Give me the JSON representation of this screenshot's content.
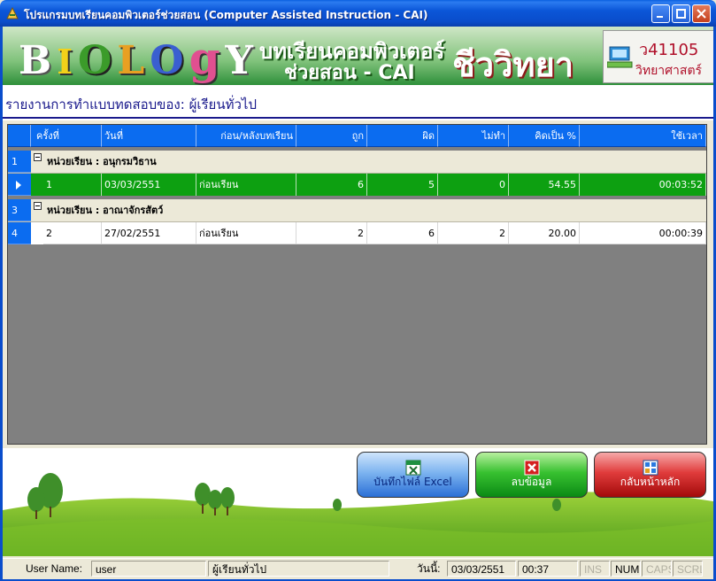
{
  "window": {
    "title": "โปรแกรมบทเรียนคอมพิวเตอร์ช่วยสอน (Computer Assisted Instruction - CAI)"
  },
  "banner": {
    "logo_letters": [
      "B",
      "I",
      "O",
      "L",
      "O",
      "g",
      "Y"
    ],
    "subtitle_line1": "บทเรียนคอมพิวเตอร์",
    "subtitle_line2": "ช่วยสอน - CAI",
    "subject": "ชีววิทยา",
    "course_code": "ว41105",
    "course_group": "วิทยาศาสตร์"
  },
  "report": {
    "title": "รายงานการทำแบบทดสอบของ: ผู้เรียนทั่วไป"
  },
  "grid": {
    "columns": [
      "ครั้งที่",
      "วันที่",
      "ก่อน/หลังบทเรียน",
      "ถูก",
      "ผิด",
      "ไม่ทำ",
      "คิดเป็น %",
      "ใช้เวลา"
    ],
    "rows": [
      {
        "rownum": "1",
        "group_label": "หน่วยเรียน : อนุกรมวิธาน"
      },
      {
        "rownum": "",
        "cells": [
          "1",
          "03/03/2551",
          "ก่อนเรียน",
          "6",
          "5",
          "0",
          "54.55",
          "00:03:52"
        ]
      },
      {
        "rownum": "3",
        "group_label": "หน่วยเรียน : อาณาจักรสัตว์"
      },
      {
        "rownum": "4",
        "cells": [
          "2",
          "27/02/2551",
          "ก่อนเรียน",
          "2",
          "6",
          "2",
          "20.00",
          "00:00:39"
        ]
      }
    ]
  },
  "buttons": {
    "excel": "บันทึกไฟล์ Excel",
    "delete": "ลบข้อมูล",
    "home": "กลับหน้าหลัก"
  },
  "statusbar": {
    "username_label": "User Name:",
    "username": "user",
    "user_type": "ผู้เรียนทั่วไป",
    "date_label": "วันนี้:",
    "date": "03/03/2551",
    "time": "00:37",
    "ins": "INS",
    "num": "NUM",
    "caps": "CAPS",
    "scrl": "SCRL"
  },
  "colors": {
    "header_blue": "#0b6cf0",
    "selected_green": "#0da011"
  }
}
